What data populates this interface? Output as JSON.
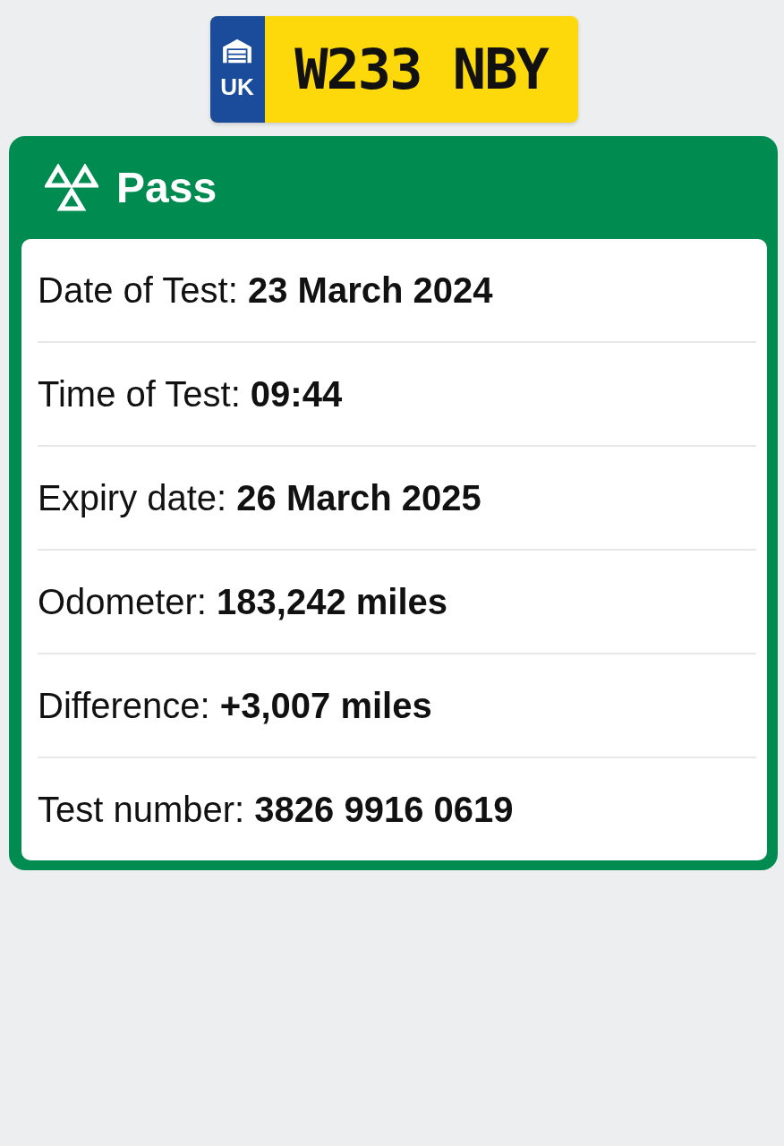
{
  "plate": {
    "country": "UK",
    "registration": "W233 NBY"
  },
  "result": {
    "kind": "pass",
    "label": "Pass"
  },
  "details": [
    {
      "text": "Date of Test: **23 March 2024**"
    },
    {
      "text": "Time of Test: **09:44**"
    },
    {
      "text": "Expiry date: **26 March 2025**"
    },
    {
      "text": "Odometer: **183,242 miles**"
    },
    {
      "text": "Difference: **+3,007 miles**"
    },
    {
      "text": "Test number: **3826 9916 0619**"
    }
  ]
}
